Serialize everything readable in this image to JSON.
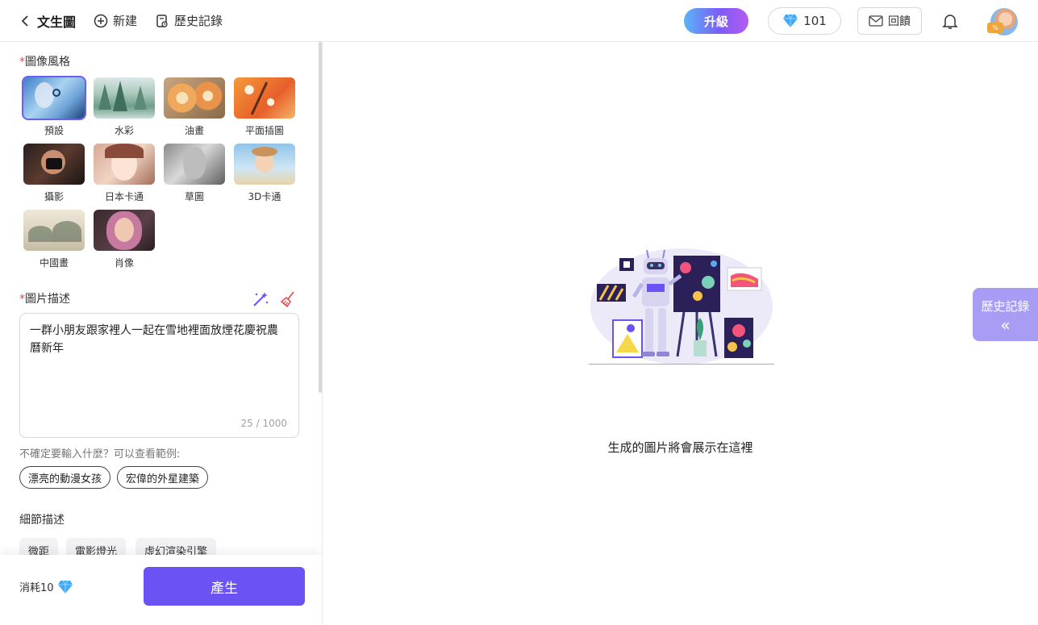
{
  "topbar": {
    "title": "文生圖",
    "new_label": "新建",
    "history_label": "歷史記錄",
    "upgrade_label": "升級",
    "gem_count": "101",
    "feedback_label": "回饋",
    "avatar_badge": "%"
  },
  "sidebar": {
    "style_section": {
      "required_mark": "*",
      "title": "圖像風格",
      "items": [
        {
          "label": "預設",
          "selected": true
        },
        {
          "label": "水彩"
        },
        {
          "label": "油畫"
        },
        {
          "label": "平面插圖"
        },
        {
          "label": "攝影"
        },
        {
          "label": "日本卡通"
        },
        {
          "label": "草圖"
        },
        {
          "label": "3D卡通"
        },
        {
          "label": "中國畫"
        },
        {
          "label": "肖像"
        }
      ]
    },
    "description_section": {
      "required_mark": "*",
      "title": "圖片描述",
      "text": "一群小朋友跟家裡人一起在雪地裡面放煙花慶祝農曆新年",
      "counter": "25 / 1000"
    },
    "hint": "不確定要輸入什麼？可以查看範例:",
    "examples": [
      "漂亮的動漫女孩",
      "宏偉的外星建築"
    ],
    "detail_section": {
      "title": "細節描述",
      "tags": [
        "微距",
        "電影燈光",
        "虛幻渲染引擎"
      ]
    },
    "footer": {
      "cost_label": "消耗10",
      "generate_label": "產生"
    }
  },
  "main": {
    "empty_text": "生成的圖片將會展示在這裡"
  },
  "history_tab": {
    "label": "歷史記錄",
    "arrow": "«"
  },
  "colors": {
    "accent": "#6b52f4",
    "history_tab": "#a89df5",
    "required": "#e5484d"
  }
}
